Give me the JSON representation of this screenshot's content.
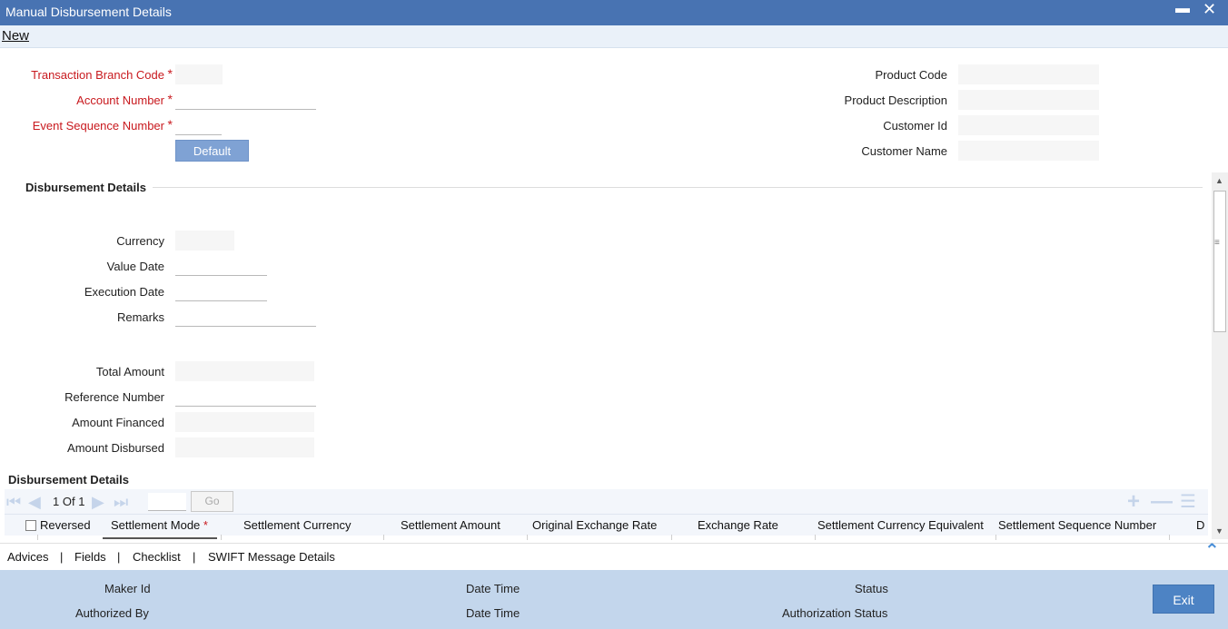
{
  "window": {
    "title": "Manual Disbursement Details",
    "minimize_icon": "minimize-icon",
    "close_icon": "close-icon"
  },
  "menu": {
    "new_label": "New"
  },
  "header_form": {
    "branch_code_label": "Transaction Branch Code",
    "account_number_label": "Account Number",
    "event_seq_label": "Event Sequence Number",
    "required_marker": "*",
    "default_button": "Default",
    "product_code_label": "Product Code",
    "product_description_label": "Product Description",
    "customer_id_label": "Customer Id",
    "customer_name_label": "Customer Name"
  },
  "disbursement": {
    "section_title": "Disbursement Details",
    "currency_label": "Currency",
    "value_date_label": "Value Date",
    "execution_date_label": "Execution Date",
    "remarks_label": "Remarks",
    "total_amount_label": "Total Amount",
    "reference_number_label": "Reference Number",
    "amount_financed_label": "Amount Financed",
    "amount_disbursed_label": "Amount Disbursed"
  },
  "grid": {
    "section_title": "Disbursement Details",
    "page_current": "1",
    "page_of": "Of",
    "page_total": "1",
    "go_label": "Go",
    "columns": [
      "Reversed",
      "Settlement Mode",
      "Settlement Currency",
      "Settlement Amount",
      "Original Exchange Rate",
      "Exchange Rate",
      "Settlement Currency Equivalent",
      "Settlement Sequence Number",
      "D"
    ],
    "required_marker": "*"
  },
  "bottom_links": {
    "advices": "Advices",
    "fields": "Fields",
    "checklist": "Checklist",
    "swift": "SWIFT Message Details",
    "separator": "|"
  },
  "footer": {
    "maker_id": "Maker Id",
    "date_time_1": "Date Time",
    "status": "Status",
    "authorized_by": "Authorized By",
    "date_time_2": "Date Time",
    "authorization_status": "Authorization Status",
    "exit_label": "Exit"
  },
  "colors": {
    "titlebar": "#4873b2",
    "accent": "#4d83c4",
    "footer": "#c3d6ec",
    "required": "#c8191e"
  }
}
